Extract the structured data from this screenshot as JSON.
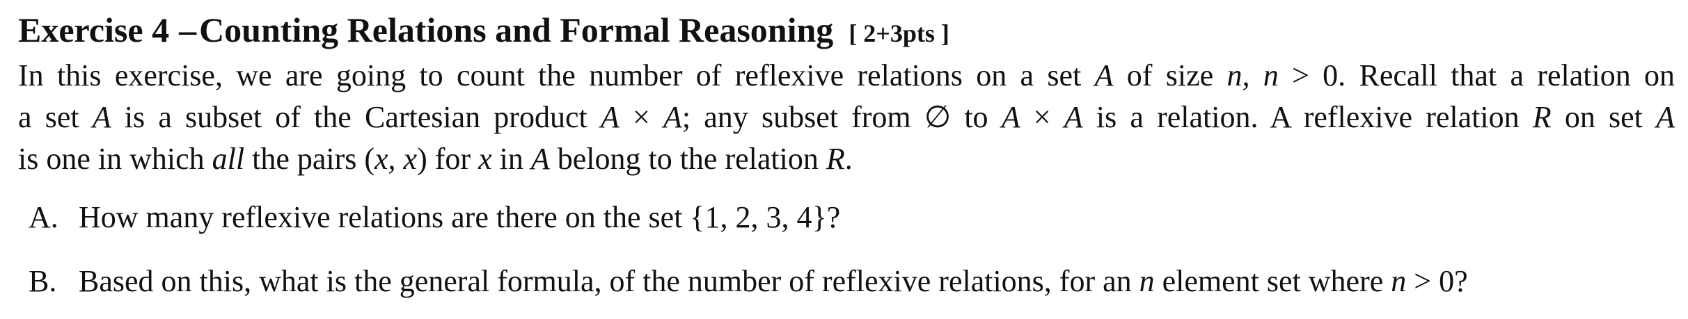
{
  "exercise": {
    "number_label": "Exercise 4",
    "dash": "–",
    "title": "Counting Relations and Formal Reasoning",
    "points": "[ 2+3pts ]"
  },
  "intro": {
    "line1": {
      "t1": "In this exercise, we are going to count the number of reflexive relations on a set ",
      "m1": "A",
      "t2": " of size ",
      "m2": "n, n",
      "t3": " > 0. Recall that a relation on"
    },
    "line2": {
      "t1": "a set ",
      "m1": "A",
      "t2": " is a subset of the Cartesian product ",
      "m2": "A",
      "t3": " × ",
      "m3": "A",
      "t4": "; any subset from ∅ to ",
      "m4": "A",
      "t5": " × ",
      "m5": "A",
      "t6": " is a relation. A reflexive relation ",
      "m6": "R",
      "t7": " on set ",
      "m7": "A"
    },
    "line3": {
      "t1": "is one in which ",
      "emph": "all",
      "t2": " the pairs (",
      "m1": "x, x",
      "t3": ") for ",
      "m2": "x",
      "t4": " in ",
      "m3": "A",
      "t5": " belong to the relation ",
      "m4": "R",
      "t6": "."
    }
  },
  "questions": [
    {
      "label": "A.",
      "t1": "How many reflexive relations are there on the set {1, 2, 3, 4}?"
    },
    {
      "label": "B.",
      "t1": "Based on this, what is the general formula, of the number of reflexive relations, for an ",
      "m1": "n",
      "t2": " element set where ",
      "m2": "n",
      "t3": " > 0?"
    }
  ]
}
